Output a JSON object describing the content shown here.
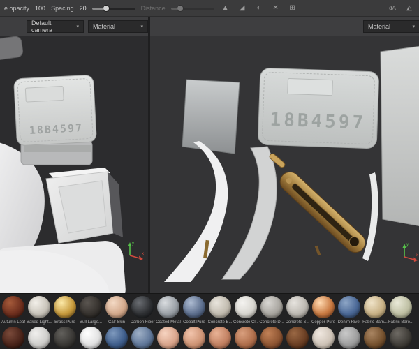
{
  "toolbar": {
    "opacity_label": "e opacity",
    "opacity_value": "100",
    "spacing_label": "Spacing",
    "spacing_value": "20",
    "distance_label": "Distance",
    "icons": [
      {
        "name": "triangle-icon",
        "glyph": "▲"
      },
      {
        "name": "falloff-icon",
        "glyph": "◢"
      },
      {
        "name": "shading-sphere-icon",
        "glyph": "◐"
      },
      {
        "name": "symmetry-icon",
        "glyph": "✕"
      },
      {
        "name": "grid-icon",
        "glyph": "⊞"
      }
    ],
    "right_icons": [
      {
        "name": "logo-icon-1",
        "glyph": "dA"
      },
      {
        "name": "logo-icon-2",
        "glyph": "◭"
      }
    ]
  },
  "viewport3d": {
    "camera_dropdown": "Default camera",
    "shading_dropdown": "Material",
    "plate_text": "18B4597"
  },
  "viewport2d": {
    "shading_dropdown": "Material",
    "plate_text": "18B4597"
  },
  "gizmo": {
    "x": "x",
    "y": "y"
  },
  "colors": {
    "toolbar_bg": "#3b3b3c",
    "viewport_left_bg": "#2c2c2e",
    "viewport_right_bg": "#343436",
    "shelf_bg": "#222223",
    "axis_x": "#d24a3e",
    "axis_y": "#57c24a",
    "plate": "#d6d9d8",
    "lever_bronze": "#a98244"
  },
  "shelf": {
    "rows": [
      [
        {
          "name": "Autumn Leaf",
          "hi": "#a55a3a",
          "mid": "#6e2f1e",
          "dark": "#3a150c"
        },
        {
          "name": "Baked Light...",
          "hi": "#f2efe9",
          "mid": "#c9c4ba",
          "dark": "#8a857c"
        },
        {
          "name": "Brass Pure",
          "hi": "#fce9a8",
          "mid": "#c79a3c",
          "dark": "#6b4a14"
        },
        {
          "name": "Bull Large...",
          "hi": "#5a5550",
          "mid": "#36322e",
          "dark": "#171513"
        },
        {
          "name": "Calf Skin",
          "hi": "#f3d9c4",
          "mid": "#d3a98c",
          "dark": "#8f6a52"
        },
        {
          "name": "Carbon Fiber",
          "hi": "#6a6d72",
          "mid": "#2e3033",
          "dark": "#121315"
        },
        {
          "name": "Coated Metal",
          "hi": "#d9dcdf",
          "mid": "#9aa0a6",
          "dark": "#5a6066"
        },
        {
          "name": "Cobalt Pure",
          "hi": "#aebcd2",
          "mid": "#5d6f8e",
          "dark": "#2c3a52"
        },
        {
          "name": "Concrete B...",
          "hi": "#e8e4dc",
          "mid": "#c2bcb0",
          "dark": "#847e72"
        },
        {
          "name": "Concrete Cl...",
          "hi": "#f4f3f0",
          "mid": "#d8d6d0",
          "dark": "#9a978f"
        },
        {
          "name": "Concrete D...",
          "hi": "#d8d6d2",
          "mid": "#a9a6a0",
          "dark": "#6d6a64"
        },
        {
          "name": "Concrete S...",
          "hi": "#e6e3de",
          "mid": "#bdb9b2",
          "dark": "#7f7b74"
        },
        {
          "name": "Copper Pure",
          "hi": "#ffd9b0",
          "mid": "#c97a42",
          "dark": "#7a3c1a"
        },
        {
          "name": "Denim Rivet",
          "hi": "#8ea6c6",
          "mid": "#4a6896",
          "dark": "#23344e"
        },
        {
          "name": "Fabric Bam...",
          "hi": "#efe3c8",
          "mid": "#c9b286",
          "dark": "#8a764f"
        },
        {
          "name": "Fabric Baro...",
          "hi": "#e9e9d8",
          "mid": "#bfc0a4",
          "dark": "#7f8066"
        }
      ],
      [
        {
          "name": "",
          "hi": "#7a4a3a",
          "mid": "#4a241a",
          "dark": "#200e08"
        },
        {
          "name": "",
          "hi": "#f0efed",
          "mid": "#cfcecb",
          "dark": "#94928e"
        },
        {
          "name": "",
          "hi": "#62605c",
          "mid": "#3a3835",
          "dark": "#1b1a18"
        },
        {
          "name": "",
          "hi": "#ffffff",
          "mid": "#e2e2e2",
          "dark": "#a8a8a8"
        },
        {
          "name": "",
          "hi": "#7e99bd",
          "mid": "#3f5e8c",
          "dark": "#1f2f49"
        },
        {
          "name": "",
          "hi": "#9fb0c6",
          "mid": "#61789a",
          "dark": "#324257"
        },
        {
          "name": "",
          "hi": "#f6d3c0",
          "mid": "#d9a58c",
          "dark": "#9c6d56"
        },
        {
          "name": "",
          "hi": "#f2c4ac",
          "mid": "#cf9576",
          "dark": "#936049"
        },
        {
          "name": "",
          "hi": "#e8b295",
          "mid": "#c28162",
          "dark": "#84503a"
        },
        {
          "name": "",
          "hi": "#d99f7e",
          "mid": "#b06f4c",
          "dark": "#70402a"
        },
        {
          "name": "",
          "hi": "#c08056",
          "mid": "#8f5633",
          "dark": "#52291a"
        },
        {
          "name": "",
          "hi": "#9a6844",
          "mid": "#6b3f24",
          "dark": "#371d0e"
        },
        {
          "name": "",
          "hi": "#efe7df",
          "mid": "#cfc4b8",
          "dark": "#948a7e"
        },
        {
          "name": "",
          "hi": "#c9c9c9",
          "mid": "#9e9e9e",
          "dark": "#646464"
        },
        {
          "name": "",
          "hi": "#a98562",
          "mid": "#76522f",
          "dark": "#3d2714"
        },
        {
          "name": "",
          "hi": "#6e6a64",
          "mid": "#403d38",
          "dark": "#1d1b18"
        }
      ]
    ]
  }
}
